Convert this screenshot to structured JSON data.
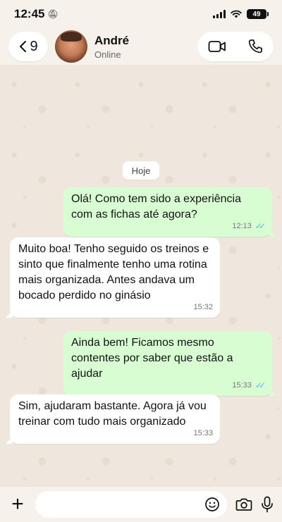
{
  "status_bar": {
    "time": "12:45",
    "battery": "49"
  },
  "header": {
    "back_count": "9",
    "contact_name": "André",
    "contact_status": "Online"
  },
  "chat": {
    "date_label": "Hoje",
    "messages": [
      {
        "direction": "out",
        "text": "Olá! Como tem sido a experiência com as fichas até agora?",
        "time": "12:13",
        "read": true
      },
      {
        "direction": "in",
        "text": "Muito boa! Tenho seguido os treinos e sinto que finalmente tenho uma rotina mais organizada. Antes andava um bocado perdido no ginásio",
        "time": "15:32"
      },
      {
        "direction": "out",
        "text": "Ainda bem! Ficamos mesmo contentes por saber que estão a ajudar",
        "time": "15:33",
        "read": true
      },
      {
        "direction": "in",
        "text": "Sim, ajudaram bastante. Agora já vou treinar com tudo mais organizado",
        "time": "15:33"
      }
    ]
  },
  "composer": {
    "placeholder": ""
  },
  "colors": {
    "outgoing_bubble": "#d9fdd3",
    "incoming_bubble": "#ffffff",
    "read_ticks": "#53bdeb"
  },
  "icons": [
    "back-chevron-icon",
    "video-call-icon",
    "phone-icon",
    "plus-icon",
    "sticker-icon",
    "camera-icon",
    "microphone-icon"
  ]
}
